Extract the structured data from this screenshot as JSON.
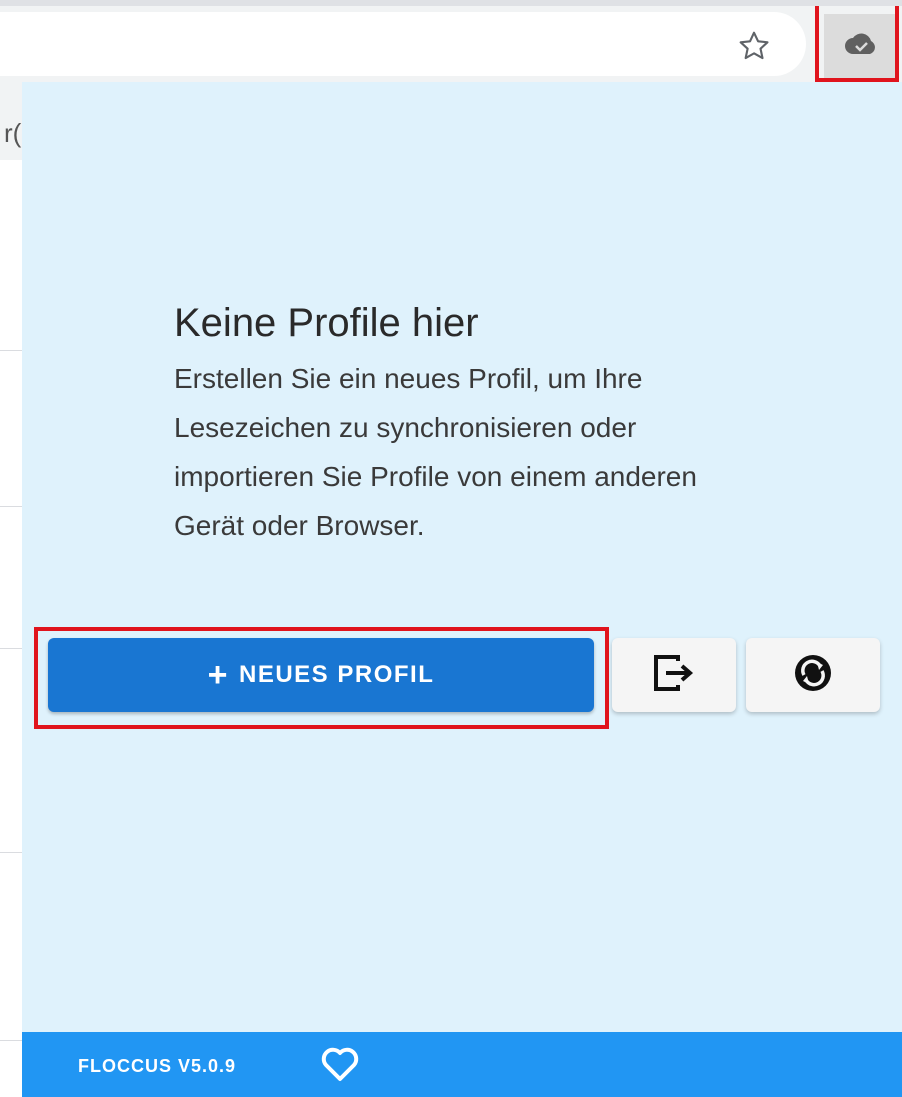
{
  "popup": {
    "empty_title": "Keine Profile hier",
    "empty_text": "Erstellen Sie ein neues Profil, um Ihre Lesezeichen zu synchronisieren oder importieren Sie Profile von einem anderen Gerät oder Browser.",
    "new_profile_label": "NEUES PROFIL",
    "plus_glyph": "+",
    "import_icon": "import-export-icon",
    "sync_icon": "sync-circle-icon",
    "footer_version": "FLOCCUS V5.0.9",
    "footer_icon": "heart-icon"
  },
  "browser": {
    "bookmark_icon": "star-icon",
    "extension_icon": "cloud-icon",
    "page_fragment": "r("
  },
  "colors": {
    "popup_bg": "#dff2fc",
    "primary": "#1976d2",
    "footer": "#2196f3",
    "highlight": "#e0141d"
  }
}
